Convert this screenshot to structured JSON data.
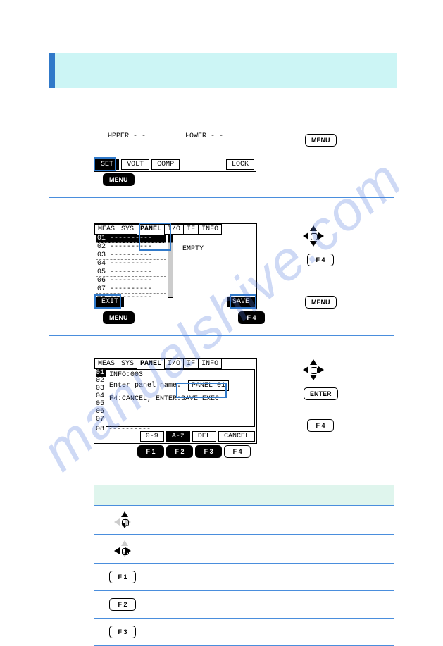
{
  "watermark": "manualshive.com",
  "screen1": {
    "upper": "UPPER",
    "lower": "LOWER",
    "dashes": "- - - - -",
    "soft": {
      "set": "SET",
      "volt": "VOLT",
      "comp": "COMP",
      "lock": "LOCK"
    }
  },
  "screen2": {
    "tabs": {
      "meas": "MEAS",
      "sys": "SYS",
      "panel": "PANEL",
      "io": "I/O",
      "if": "IF",
      "info": "INFO"
    },
    "rows": {
      "r1": "01",
      "r2": "02",
      "r3": "03",
      "r4": "04",
      "r5": "05",
      "r6": "06",
      "r7": "07",
      "r8": "08"
    },
    "empty": "EMPTY",
    "soft": {
      "exit": "EXIT",
      "save": "SAVE"
    }
  },
  "screen3": {
    "tabs": {
      "meas": "MEAS",
      "sys": "SYS",
      "panel": "PANEL",
      "io": "I/O",
      "if": "IF",
      "info": "INFO"
    },
    "info": "INFO:003",
    "prompt": "Enter panel name.",
    "value": "PANEL_01",
    "hint": "F4:CANCEL, ENTER:SAVE EXEC",
    "row8": "08 ----------",
    "soft": {
      "num": "0-9",
      "alpha": "A-z",
      "del": "DEL",
      "cancel": "CANCEL"
    }
  },
  "keys": {
    "menu": "MENU",
    "f1": "F 1",
    "f2": "F 2",
    "f3": "F 3",
    "f4": "F 4",
    "enter": "ENTER"
  }
}
